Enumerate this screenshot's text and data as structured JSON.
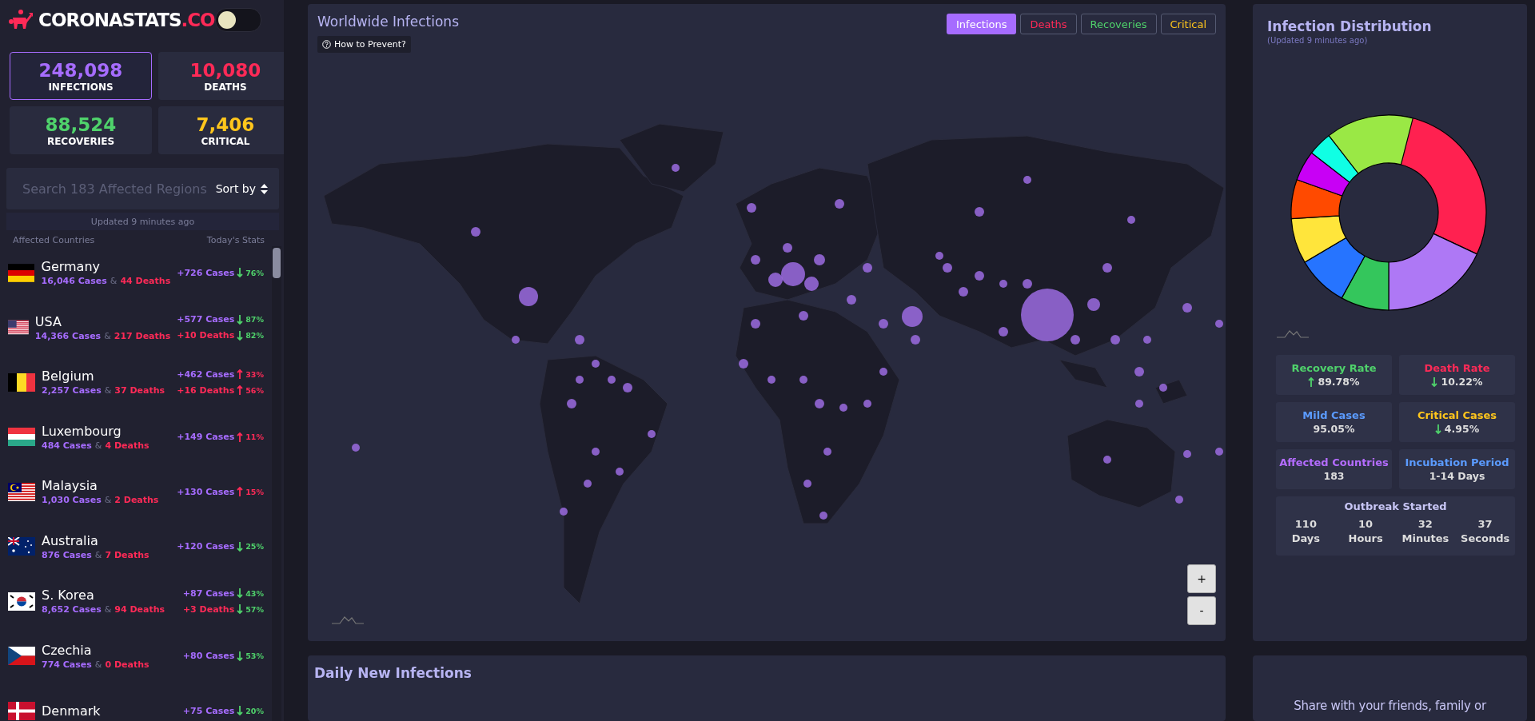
{
  "logo": {
    "name": "CORONASTATS",
    "suffix": ".CO"
  },
  "theme_toggle": {
    "light_mode": false
  },
  "summary": [
    {
      "value": "248,098",
      "label": "INFECTIONS",
      "color": "#a66cff",
      "selected": true
    },
    {
      "value": "10,080",
      "label": "DEATHS",
      "color": "#ff2a57",
      "selected": false
    },
    {
      "value": "88,524",
      "label": "RECOVERIES",
      "color": "#4fd26b",
      "selected": false
    },
    {
      "value": "7,406",
      "label": "CRITICAL",
      "color": "#ffc61c",
      "selected": false
    }
  ],
  "search": {
    "placeholder": "Search 183 Affected Regions",
    "sort_label": "Sort by"
  },
  "updated": "Updated 9 minutes ago",
  "list_header": {
    "left": "Affected Countries",
    "right": "Today's Stats"
  },
  "countries": [
    {
      "name": "Germany",
      "flag": {
        "kind": "de"
      },
      "cases": "16,046 Cases",
      "sep": "&",
      "deaths": "44 Deaths",
      "today": [
        {
          "kind": "cases",
          "text": "+726 Cases",
          "rising": false,
          "change": "76%"
        }
      ]
    },
    {
      "name": "USA",
      "flag": {
        "kind": "us"
      },
      "cases": "14,366 Cases",
      "sep": "&",
      "deaths": "217 Deaths",
      "today": [
        {
          "kind": "cases",
          "text": "+577 Cases",
          "rising": false,
          "change": "87%"
        },
        {
          "kind": "deaths",
          "text": "+10 Deaths",
          "rising": false,
          "change": "82%"
        }
      ]
    },
    {
      "name": "Belgium",
      "flag": {
        "kind": "be"
      },
      "cases": "2,257 Cases",
      "sep": "&",
      "deaths": "37 Deaths",
      "today": [
        {
          "kind": "cases",
          "text": "+462 Cases",
          "rising": true,
          "change": "33%"
        },
        {
          "kind": "deaths",
          "text": "+16 Deaths",
          "rising": true,
          "change": "56%"
        }
      ]
    },
    {
      "name": "Luxembourg",
      "flag": {
        "kind": "lu"
      },
      "cases": "484 Cases",
      "sep": "&",
      "deaths": "4 Deaths",
      "today": [
        {
          "kind": "cases",
          "text": "+149 Cases",
          "rising": true,
          "change": "11%"
        }
      ]
    },
    {
      "name": "Malaysia",
      "flag": {
        "kind": "my"
      },
      "cases": "1,030 Cases",
      "sep": "&",
      "deaths": "2 Deaths",
      "today": [
        {
          "kind": "cases",
          "text": "+130 Cases",
          "rising": true,
          "change": "15%"
        }
      ]
    },
    {
      "name": "Australia",
      "flag": {
        "kind": "au"
      },
      "cases": "876 Cases",
      "sep": "&",
      "deaths": "7 Deaths",
      "today": [
        {
          "kind": "cases",
          "text": "+120 Cases",
          "rising": false,
          "change": "25%"
        }
      ]
    },
    {
      "name": "S. Korea",
      "flag": {
        "kind": "kr"
      },
      "cases": "8,652 Cases",
      "sep": "&",
      "deaths": "94 Deaths",
      "today": [
        {
          "kind": "cases",
          "text": "+87 Cases",
          "rising": false,
          "change": "43%"
        },
        {
          "kind": "deaths",
          "text": "+3 Deaths",
          "rising": false,
          "change": "57%"
        }
      ]
    },
    {
      "name": "Czechia",
      "flag": {
        "kind": "cz"
      },
      "cases": "774 Cases",
      "sep": "&",
      "deaths": "0 Deaths",
      "today": [
        {
          "kind": "cases",
          "text": "+80 Cases",
          "rising": false,
          "change": "53%"
        }
      ]
    },
    {
      "name": "Denmark",
      "flag": {
        "kind": "dk"
      },
      "today": [
        {
          "kind": "cases",
          "text": "+75 Cases",
          "rising": false,
          "change": "20%"
        }
      ]
    }
  ],
  "map_panel": {
    "title": "Worldwide Infections",
    "help_button": "How to Prevent?",
    "tabs": [
      {
        "label": "Infections",
        "color": "#a66cff",
        "selected": true
      },
      {
        "label": "Deaths",
        "color": "#ff2a57",
        "selected": false
      },
      {
        "label": "Recoveries",
        "color": "#4fd26b",
        "selected": false
      },
      {
        "label": "Critical",
        "color": "#ffc61c",
        "selected": false
      }
    ],
    "zoom_in": "+",
    "zoom_out": "-"
  },
  "distribution": {
    "title": "Infection Distribution",
    "subtitle": "(Updated 9 minutes ago)",
    "stats": [
      {
        "label": "Recovery Rate",
        "color": "#4fd26b",
        "value": "89.78%",
        "rising": true
      },
      {
        "label": "Death Rate",
        "color": "#ff2a57",
        "value": "10.22%",
        "rising": false
      },
      {
        "label": "Mild Cases",
        "color": "#5b9bff",
        "value": "95.05%"
      },
      {
        "label": "Critical Cases",
        "color": "#ffc61c",
        "value": "4.95%",
        "rising": false
      },
      {
        "label": "Affected Countries",
        "color": "#b46cff",
        "value": "183"
      },
      {
        "label": "Incubation Period",
        "color": "#5b9bff",
        "value": "1-14 Days"
      }
    ],
    "outbreak": {
      "title": "Outbreak Started",
      "units": [
        {
          "value": "110",
          "unit": "Days"
        },
        {
          "value": "10",
          "unit": "Hours"
        },
        {
          "value": "32",
          "unit": "Minutes"
        },
        {
          "value": "37",
          "unit": "Seconds"
        }
      ]
    }
  },
  "daily_panel": {
    "title": "Daily New Infections"
  },
  "share_panel": {
    "text": "Share with your friends, family or"
  }
}
